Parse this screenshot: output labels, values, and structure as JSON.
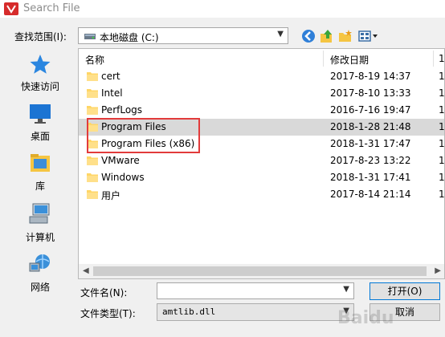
{
  "window": {
    "title": "Search File"
  },
  "lookin": {
    "label": "查找范围(I):",
    "value": "本地磁盘 (C:)"
  },
  "toolbar": {
    "icons": [
      "back-icon",
      "up-folder-icon",
      "new-folder-icon",
      "view-menu-icon"
    ]
  },
  "places": [
    {
      "label": "快速访问",
      "icon": "star-icon"
    },
    {
      "label": "桌面",
      "icon": "desktop-icon"
    },
    {
      "label": "库",
      "icon": "library-icon"
    },
    {
      "label": "计算机",
      "icon": "computer-icon"
    },
    {
      "label": "网络",
      "icon": "network-icon"
    }
  ],
  "filelist": {
    "columns": {
      "name": "名称",
      "date": "修改日期",
      "more": "1"
    },
    "rows": [
      {
        "name": "cert",
        "date": "2017-8-19 14:37",
        "more": "1"
      },
      {
        "name": "Intel",
        "date": "2017-8-10 13:33",
        "more": "1"
      },
      {
        "name": "PerfLogs",
        "date": "2016-7-16 19:47",
        "more": "1"
      },
      {
        "name": "Program Files",
        "date": "2018-1-28 21:48",
        "more": "1",
        "selected": true
      },
      {
        "name": "Program Files (x86)",
        "date": "2018-1-31 17:47",
        "more": "1"
      },
      {
        "name": "VMware",
        "date": "2017-8-23 13:22",
        "more": "1"
      },
      {
        "name": "Windows",
        "date": "2018-1-31 17:41",
        "more": "1"
      },
      {
        "name": "用户",
        "date": "2017-8-14 21:14",
        "more": "1"
      }
    ]
  },
  "filename": {
    "label": "文件名(N):",
    "value": ""
  },
  "filetype": {
    "label": "文件类型(T):",
    "value": "amtlib.dll"
  },
  "buttons": {
    "open": "打开(O)",
    "cancel": "取消"
  },
  "watermark": "Baidu",
  "colors": {
    "folder": "#ffd666",
    "highlight": "#e23b3b",
    "selection": "#d9d9d9",
    "app_red": "#d62b2b"
  }
}
